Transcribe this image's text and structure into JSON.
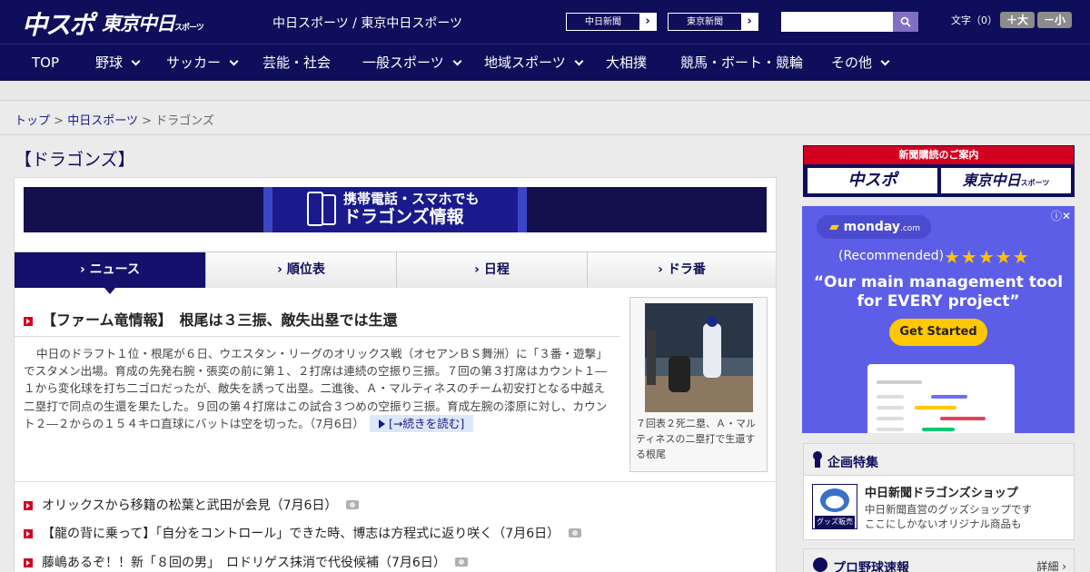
{
  "header": {
    "logo_primary": "中スポ",
    "logo_secondary": "東京中日",
    "logo_secondary_small": "スポーツ",
    "site_links": "中日スポーツ / 東京中日スポーツ",
    "paper_buttons": [
      {
        "label": "中日新聞",
        "arrow": "›"
      },
      {
        "label": "東京新聞",
        "arrow": "›"
      }
    ],
    "search": {
      "placeholder": "",
      "value": ""
    },
    "font_size": {
      "label": "文字（0）",
      "increase": "＋大",
      "decrease": "－小"
    }
  },
  "nav": {
    "items": [
      {
        "label": "TOP",
        "has_dropdown": false
      },
      {
        "label": "野球",
        "has_dropdown": true
      },
      {
        "label": "サッカー",
        "has_dropdown": true
      },
      {
        "label": "芸能・社会",
        "has_dropdown": false
      },
      {
        "label": "一般スポーツ",
        "has_dropdown": true
      },
      {
        "label": "地域スポーツ",
        "has_dropdown": true
      },
      {
        "label": "大相撲",
        "has_dropdown": false
      },
      {
        "label": "競馬・ボート・競輪",
        "has_dropdown": false
      },
      {
        "label": "その他",
        "has_dropdown": true
      }
    ]
  },
  "breadcrumb": {
    "items": [
      "トップ",
      "中日スポーツ",
      "ドラゴンズ"
    ],
    "separator": ">"
  },
  "section_title": "【ドラゴンズ】",
  "banner": {
    "line1": "携帯電話・スマホでも",
    "line2": "ドラゴンズ情報"
  },
  "tabs": [
    {
      "label": "› ニュース",
      "active": true
    },
    {
      "label": "› 順位表",
      "active": false
    },
    {
      "label": "› 日程",
      "active": false
    },
    {
      "label": "› ドラ番",
      "active": false
    }
  ],
  "top_story": {
    "headline": "【ファーム竜情報】　根尾は３三振、敵失出塁では生還",
    "lead": "中日のドラフト１位・根尾が６日、ウエスタン・リーグのオリックス戦（オセアンＢＳ舞洲）に「３番・遊撃」でスタメン出場。育成の先発右腕・張奕の前に第１、２打席は連続の空振り三振。７回の第３打席はカウント１―１から変化球を打ち二ゴロだったが、敵失を誘って出塁。二進後、Ａ・マルティネスのチーム初安打となる中越え二塁打で同点の生還を果たした。９回の第４打席はこの試合３つめの空振り三振。育成左腕の漆原に対し、カウント２―２からの１５４キロ直球にバットは空を切った。（7月6日）",
    "more_label": "[→続きを読む]",
    "photo_caption": "７回表２死二塁、Ａ・マルティネスの二塁打で生還する根尾"
  },
  "news_list": [
    {
      "title": "オリックスから移籍の松葉と武田が会見（7月6日）",
      "has_photo": true
    },
    {
      "title": "【龍の背に乗って】「自分をコントロール」できた時、博志は方程式に返り咲く（7月6日）",
      "has_photo": true
    },
    {
      "title": "藤嶋あるぞ！！新「８回の男」　ロドリゲス抹消で代役候補（7月6日）",
      "has_photo": true
    }
  ],
  "sidebar": {
    "subscription": {
      "title": "新聞購読のご案内",
      "logos": [
        "中スポ",
        "東京中日"
      ],
      "logo_small": "スポーツ"
    },
    "ad": {
      "brand": "monday",
      "brand_suffix": ".com",
      "recommended": "(Recommended)",
      "stars": "★★★★★",
      "rating": 4.5,
      "headline_line1": "“Our main management tool",
      "headline_line2": "for EVERY project”",
      "cta": "Get Started",
      "info_icons": "ⓘ✕"
    },
    "feature": {
      "title": "企画特集",
      "shop_title": "中日新聞ドラゴンズショップ",
      "shop_desc_line1": "中日新聞直営のグッズショップです",
      "shop_desc_line2": "ここにしかないオリジナル商品も",
      "shop_badge": "グッズ販売中"
    },
    "scores": {
      "title": "プロ野球速報",
      "detail": "詳細 ›"
    }
  },
  "colors": {
    "navy": "#0f0e5a",
    "accent_red": "#d4001f",
    "ad_purple": "#5c5ee8",
    "ad_yellow": "#ffc800"
  }
}
